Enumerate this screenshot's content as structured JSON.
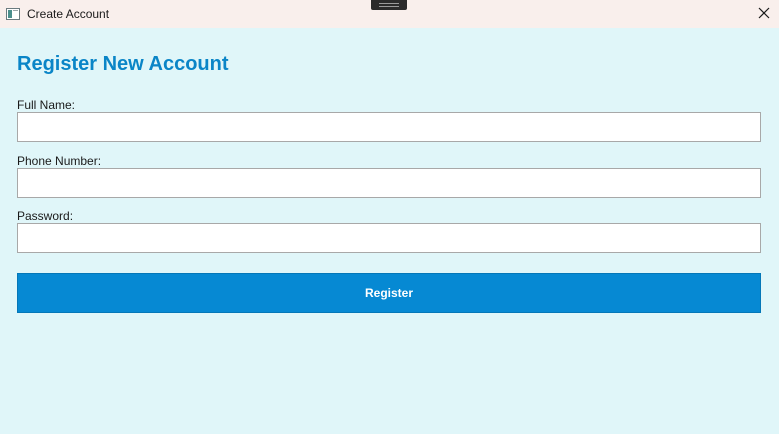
{
  "window": {
    "title": "Create Account",
    "app_icon": "window-app-icon",
    "close_icon": "close-icon"
  },
  "form": {
    "heading": "Register New Account",
    "fields": [
      {
        "label": "Full Name:",
        "value": "",
        "placeholder": ""
      },
      {
        "label": "Phone Number:",
        "value": "",
        "placeholder": ""
      },
      {
        "label": "Password:",
        "value": "",
        "placeholder": ""
      }
    ],
    "submit_label": "Register"
  },
  "colors": {
    "page_background": "#e0f6f9",
    "titlebar_background": "#f9efec",
    "heading_accent": "#0a85c7",
    "button_background": "#0689d3",
    "button_text": "#ffffff"
  }
}
